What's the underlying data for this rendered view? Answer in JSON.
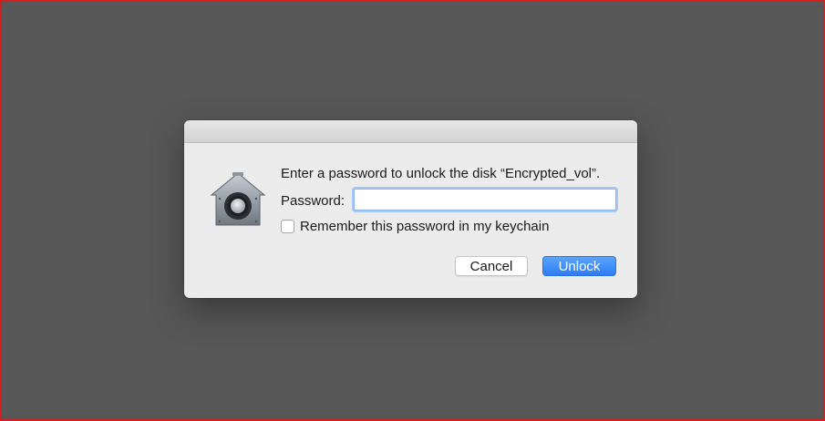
{
  "dialog": {
    "message": "Enter a password to unlock the disk “Encrypted_vol”.",
    "password_label": "Password:",
    "password_value": "",
    "remember_label": "Remember this password in my keychain",
    "remember_checked": false,
    "cancel_label": "Cancel",
    "unlock_label": "Unlock",
    "icon": "security-lock-house-icon"
  },
  "colors": {
    "background": "#575757",
    "frame_border": "#d21f1f",
    "dialog_bg": "#ececec",
    "accent": "#2e7cf6"
  }
}
